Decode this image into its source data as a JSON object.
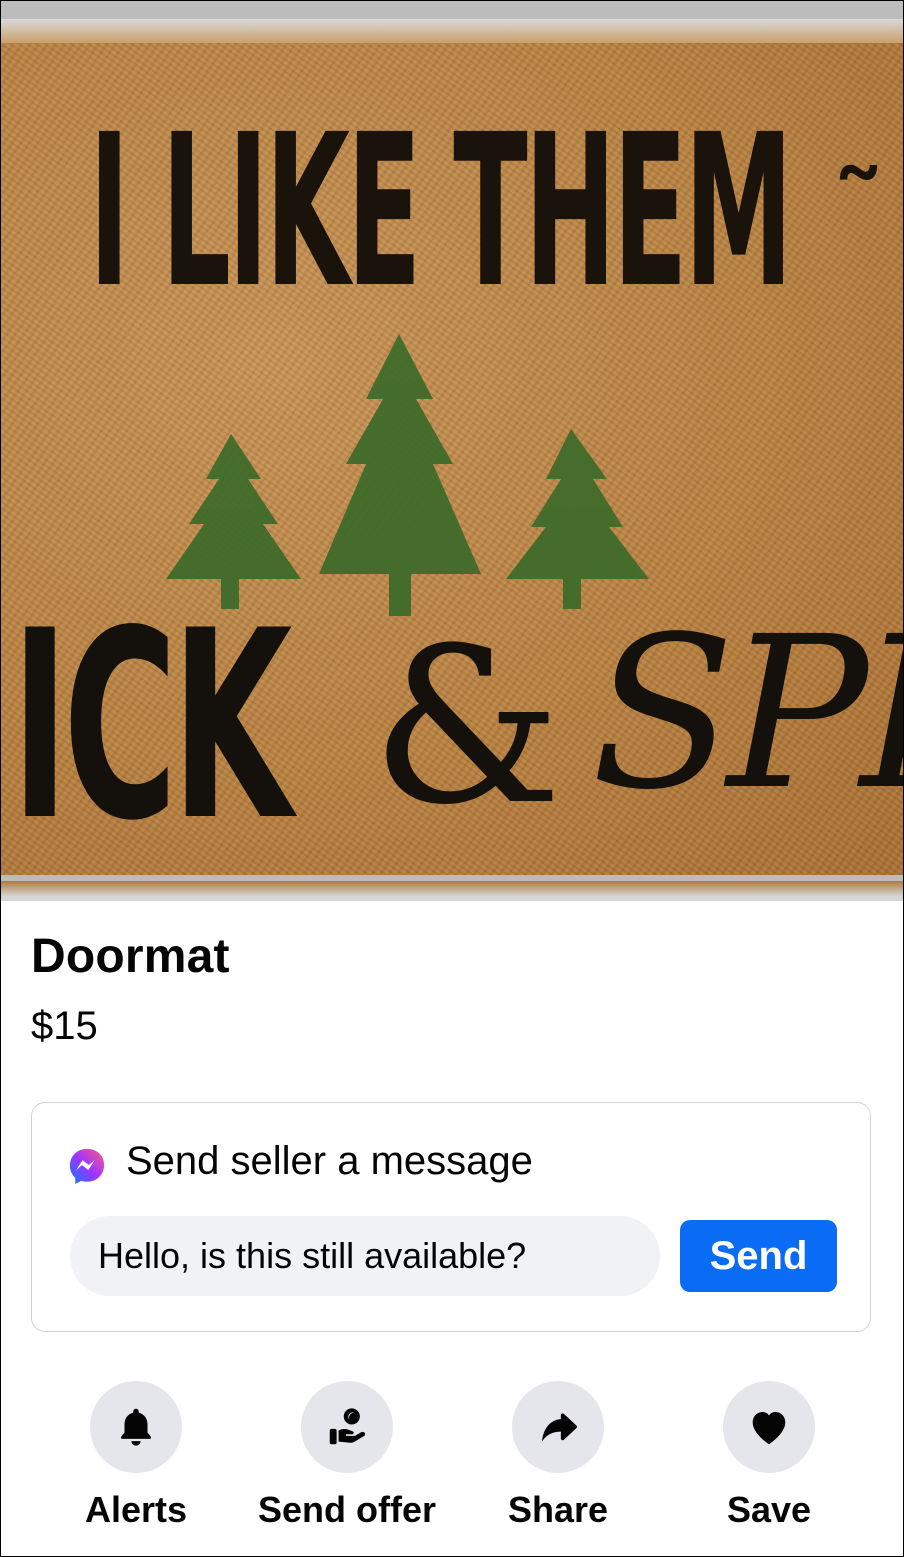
{
  "listing": {
    "photo_alt": "I LIKE THEM THICK & SPRUCE doormat",
    "mat_text": {
      "line1": "I LIKE THEM",
      "line2_left": "ICK",
      "ampersand": "&",
      "line2_script": "SPRU"
    },
    "title": "Doormat",
    "price": "$15"
  },
  "message": {
    "icon": "messenger-icon",
    "heading": "Send seller a message",
    "input_value": "Hello, is this still available?",
    "send_label": "Send",
    "send_color": "#0a6cf5"
  },
  "actions": [
    {
      "label": "Alerts",
      "icon": "bell-icon"
    },
    {
      "label": "Send offer",
      "icon": "offer-hand-icon"
    },
    {
      "label": "Share",
      "icon": "share-arrow-icon"
    },
    {
      "label": "Save",
      "icon": "heart-icon"
    }
  ]
}
